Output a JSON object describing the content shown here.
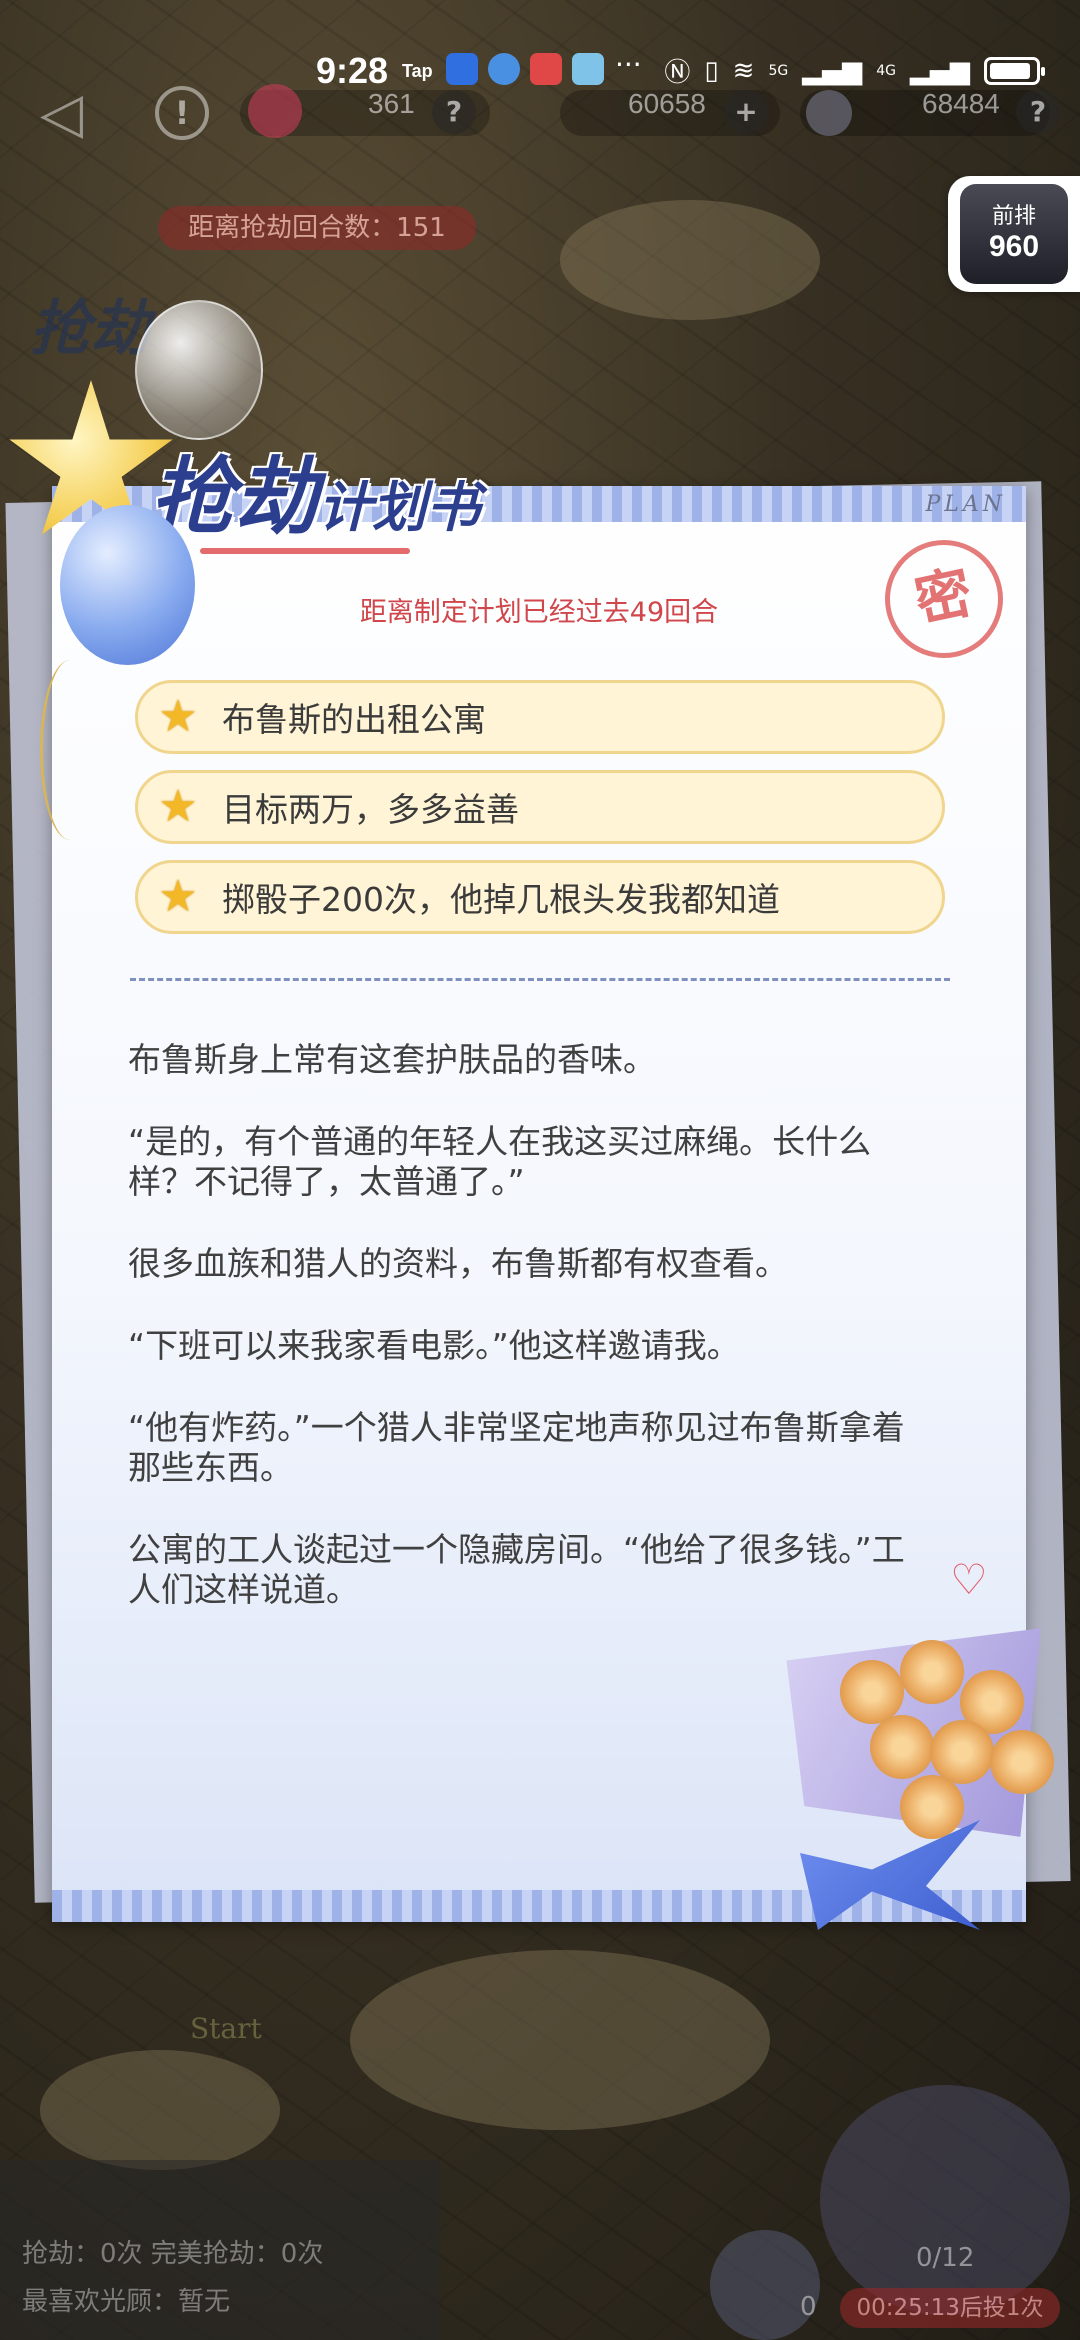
{
  "status_bar": {
    "time": "9:28",
    "tap_label": "Tap",
    "more_dots": "···",
    "network_5g": "5G",
    "network_4g": "4G"
  },
  "game_bar": {
    "resource_1": "361",
    "resource_2": "60658",
    "resource_3": "68484",
    "help_icon": "?",
    "plus_icon": "+"
  },
  "round_counter": "距离抢劫回合数：151",
  "background_title": "抢劫",
  "float_badge": {
    "top": "前排",
    "number": "960"
  },
  "plan": {
    "title_big": "抢劫",
    "title_small": "计划书",
    "tag": "PLAN",
    "stamp": "密",
    "subtitle": "距离制定计划已经过去49回合",
    "goals": [
      "布鲁斯的出租公寓",
      "目标两万，多多益善",
      "掷骰子200次，他掉几根头发我都知道"
    ],
    "paragraphs": [
      "布鲁斯身上常有这套护肤品的香味。",
      "“是的，有个普通的年轻人在我这买过麻绳。长什么样？不记得了，太普通了。”",
      "很多血族和猎人的资料，布鲁斯都有权查看。",
      "“下班可以来我家看电影。”他这样邀请我。",
      "“他有炸药。”一个猎人非常坚定地声称见过布鲁斯拿着那些东西。",
      "公寓的工人谈起过一个隐藏房间。“他给了很多钱。”工人们这样说道。"
    ]
  },
  "bottom": {
    "robbery_line": "抢劫：0次  完美抢劫：0次",
    "favorite_line": "最喜欢光顾：暂无",
    "start_label": "Start",
    "dice_count": "0/12",
    "dice_zero": "0",
    "dice_timer": "00:25:13后投1次"
  }
}
